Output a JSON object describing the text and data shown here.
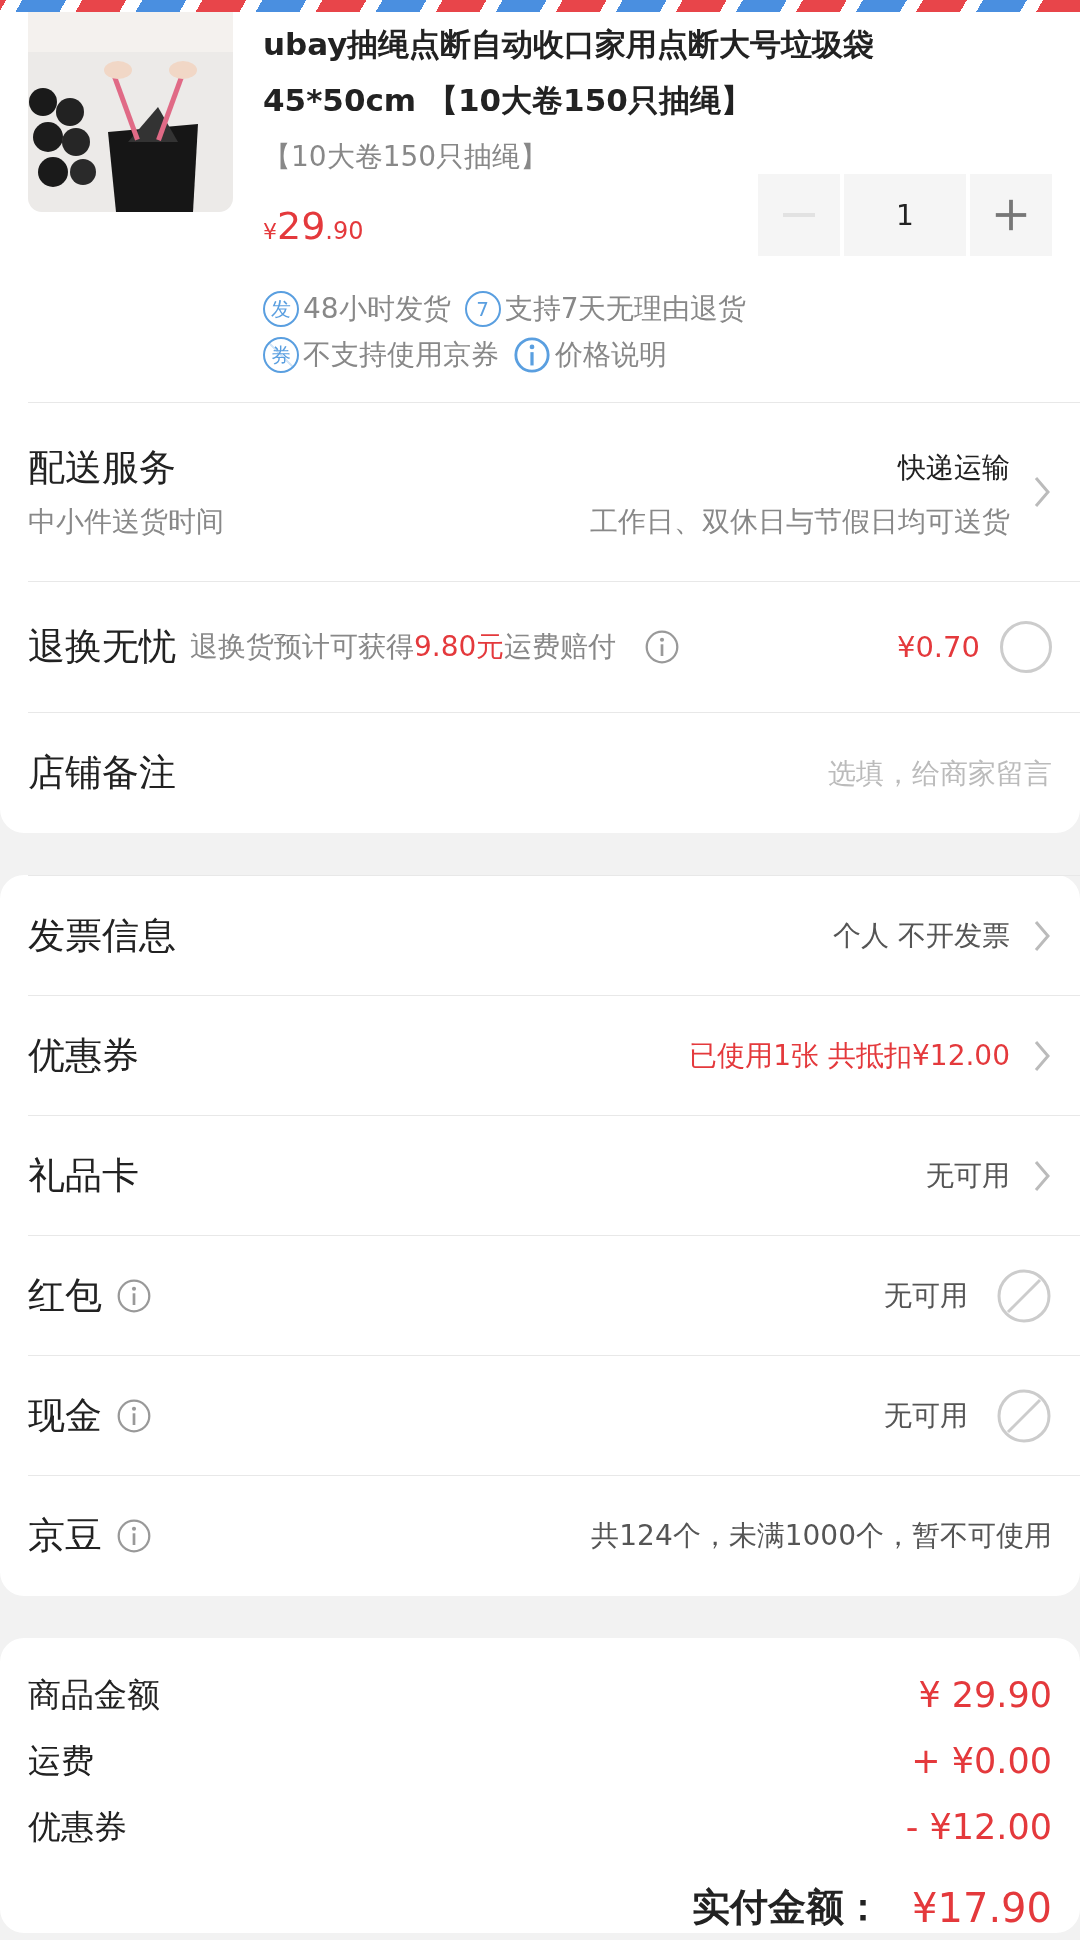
{
  "product": {
    "title_lines": [
      "ubay抽绳点断自动收口家用点断大号垃圾袋",
      "45*50cm 【10大卷150只抽绳】"
    ],
    "spec": "【10大卷150只抽绳】",
    "price": {
      "currency": "¥",
      "major": "29",
      "minor": ".90"
    },
    "quantity": "1",
    "minus_disabled": true,
    "tags": [
      {
        "kind": "badge",
        "badge": "发",
        "text": "48小时发货"
      },
      {
        "kind": "badge",
        "badge": "7",
        "text": "支持7天无理由退货"
      },
      {
        "kind": "struck",
        "badge": "券",
        "text": "不支持使用京券"
      },
      {
        "kind": "info",
        "text": "价格说明"
      }
    ]
  },
  "delivery": {
    "label": "配送服务",
    "value": "快递运输",
    "sub_label": "中小件送货时间",
    "sub_value": "工作日、双休日与节假日均可送货"
  },
  "return_insurance": {
    "label": "退换无忧",
    "desc_before": "退换货预计可获得",
    "desc_highlight": "9.80元",
    "desc_after": "运费赔付",
    "price": "¥0.70",
    "selected": false
  },
  "shop_note": {
    "label": "店铺备注",
    "placeholder": "选填，给商家留言"
  },
  "options": [
    {
      "label": "发票信息",
      "info": false,
      "value": "个人 不开发票",
      "highlight": false,
      "kind": "link"
    },
    {
      "label": "优惠券",
      "info": false,
      "value": "已使用1张 共抵扣¥12.00",
      "highlight": true,
      "kind": "link"
    },
    {
      "label": "礼品卡",
      "info": false,
      "value": "无可用",
      "highlight": false,
      "kind": "link"
    },
    {
      "label": "红包",
      "info": true,
      "value": "无可用",
      "highlight": false,
      "kind": "unavailable"
    },
    {
      "label": "现金",
      "info": true,
      "value": "无可用",
      "highlight": false,
      "kind": "unavailable"
    },
    {
      "label": "京豆",
      "info": true,
      "value": "共124个，未满1000个，暂不可使用",
      "highlight": false,
      "kind": "plain"
    }
  ],
  "summary": [
    {
      "label": "商品金额",
      "value": "¥ 29.90"
    },
    {
      "label": "运费",
      "value": "+ ¥0.00"
    },
    {
      "label": "优惠券",
      "value": "- ¥12.00"
    }
  ],
  "total": {
    "label": "实付金额：",
    "value": "¥17.90"
  }
}
